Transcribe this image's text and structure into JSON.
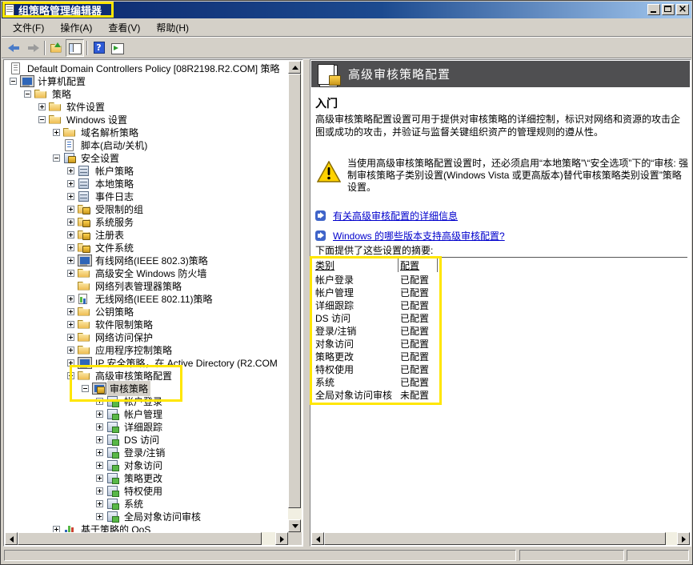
{
  "window": {
    "title": "组策略管理编辑器",
    "controls": [
      {
        "icon": "win-min",
        "name": "minimize-button"
      },
      {
        "icon": "win-max",
        "name": "maximize-button"
      },
      {
        "icon": "win-close",
        "name": "close-button"
      }
    ]
  },
  "menu": {
    "items": [
      "文件(F)",
      "操作(A)",
      "查看(V)",
      "帮助(H)"
    ]
  },
  "toolbar": {
    "buttons": [
      {
        "icon": "tb-back",
        "name": "back-button"
      },
      {
        "icon": "tb-forward",
        "name": "forward-button"
      },
      {
        "icon": "sep"
      },
      {
        "icon": "tb-up",
        "name": "up-level-button"
      },
      {
        "icon": "tb-tree",
        "name": "console-tree-toggle-button",
        "pressed": true
      },
      {
        "icon": "sep"
      },
      {
        "icon": "tb-help",
        "name": "help-button"
      },
      {
        "icon": "tb-win",
        "name": "show-window-button"
      }
    ]
  },
  "tree": {
    "items": [
      {
        "label": "Default Domain Controllers Policy [08R2198.R2.COM] 策略",
        "level": 1,
        "exp": "root",
        "icon": "gpo"
      },
      {
        "label": "计算机配置",
        "level": 1,
        "exp": "minus",
        "icon": "computer"
      },
      {
        "label": "策略",
        "level": 2,
        "exp": "minus",
        "icon": "folder"
      },
      {
        "label": "软件设置",
        "level": 3,
        "exp": "plus",
        "icon": "folder"
      },
      {
        "label": "Windows 设置",
        "level": 3,
        "exp": "minus",
        "icon": "folder"
      },
      {
        "label": "域名解析策略",
        "level": 4,
        "exp": "plus",
        "icon": "folder"
      },
      {
        "label": "脚本(启动/关机)",
        "level": 4,
        "exp": "leaf",
        "icon": "script"
      },
      {
        "label": "安全设置",
        "level": 4,
        "exp": "minus",
        "icon": "security"
      },
      {
        "label": "帐户策略",
        "level": 5,
        "exp": "plus",
        "icon": "cabinet"
      },
      {
        "label": "本地策略",
        "level": 5,
        "exp": "plus",
        "icon": "cabinet"
      },
      {
        "label": "事件日志",
        "level": 5,
        "exp": "plus",
        "icon": "cabinet"
      },
      {
        "label": "受限制的组",
        "level": 5,
        "exp": "plus",
        "icon": "folder-lock"
      },
      {
        "label": "系统服务",
        "level": 5,
        "exp": "plus",
        "icon": "folder-lock"
      },
      {
        "label": "注册表",
        "level": 5,
        "exp": "plus",
        "icon": "folder-lock"
      },
      {
        "label": "文件系统",
        "level": 5,
        "exp": "plus",
        "icon": "folder-lock"
      },
      {
        "label": "有线网络(IEEE 802.3)策略",
        "level": 5,
        "exp": "plus",
        "icon": "net"
      },
      {
        "label": "高级安全 Windows 防火墙",
        "level": 5,
        "exp": "plus",
        "icon": "folder"
      },
      {
        "label": "网络列表管理器策略",
        "level": 5,
        "exp": "leaf",
        "icon": "folder"
      },
      {
        "label": "无线网络(IEEE 802.11)策略",
        "level": 5,
        "exp": "plus",
        "icon": "wireless"
      },
      {
        "label": "公钥策略",
        "level": 5,
        "exp": "plus",
        "icon": "folder"
      },
      {
        "label": "软件限制策略",
        "level": 5,
        "exp": "plus",
        "icon": "folder"
      },
      {
        "label": "网络访问保护",
        "level": 5,
        "exp": "plus",
        "icon": "folder"
      },
      {
        "label": "应用程序控制策略",
        "level": 5,
        "exp": "plus",
        "icon": "folder"
      },
      {
        "label": "IP 安全策略，在 Active Directory (R2.COM",
        "level": 5,
        "exp": "plus",
        "icon": "ipsec"
      },
      {
        "label": "高级审核策略配置",
        "level": 5,
        "exp": "minus",
        "icon": "folder"
      },
      {
        "label": "审核策略",
        "level": 6,
        "exp": "minus",
        "icon": "audit",
        "selected": true
      },
      {
        "label": "帐户登录",
        "level": 7,
        "exp": "plus",
        "icon": "cabinet-green"
      },
      {
        "label": "帐户管理",
        "level": 7,
        "exp": "plus",
        "icon": "cabinet-green"
      },
      {
        "label": "详细跟踪",
        "level": 7,
        "exp": "plus",
        "icon": "cabinet-green"
      },
      {
        "label": "DS 访问",
        "level": 7,
        "exp": "plus",
        "icon": "cabinet-green"
      },
      {
        "label": "登录/注销",
        "level": 7,
        "exp": "plus",
        "icon": "cabinet-green"
      },
      {
        "label": "对象访问",
        "level": 7,
        "exp": "plus",
        "icon": "cabinet-green"
      },
      {
        "label": "策略更改",
        "level": 7,
        "exp": "plus",
        "icon": "cabinet-green"
      },
      {
        "label": "特权使用",
        "level": 7,
        "exp": "plus",
        "icon": "cabinet-green"
      },
      {
        "label": "系统",
        "level": 7,
        "exp": "plus",
        "icon": "cabinet-green"
      },
      {
        "label": "全局对象访问审核",
        "level": 7,
        "exp": "plus",
        "icon": "cabinet-green"
      },
      {
        "label": "基于策略的 QoS",
        "level": 4,
        "exp": "plus",
        "icon": "qos"
      }
    ]
  },
  "content": {
    "header_title": "高级审核策略配置",
    "section_title": "入门",
    "intro": "高级审核策略配置设置可用于提供对审核策略的详细控制，标识对网络和资源的攻击企图或成功的攻击，并验证与监督关键组织资产的管理规则的遵从性。",
    "warning": "当使用高级审核策略配置设置时，还必须启用“本地策略”\\“安全选项”下的“审核: 强制审核策略子类别设置(Windows Vista 或更高版本)替代审核策略类别设置”策略设置。",
    "links": [
      {
        "label": "有关高级审核配置的详细信息"
      },
      {
        "label": "Windows 的哪些版本支持高级审核配置?"
      }
    ],
    "summary_intro": "下面提供了这些设置的摘要:",
    "table": {
      "headers": [
        "类别",
        "配置"
      ],
      "rows": [
        {
          "category": "帐户登录",
          "status": "已配置"
        },
        {
          "category": "帐户管理",
          "status": "已配置"
        },
        {
          "category": "详细跟踪",
          "status": "已配置"
        },
        {
          "category": "DS 访问",
          "status": "已配置"
        },
        {
          "category": "登录/注销",
          "status": "已配置"
        },
        {
          "category": "对象访问",
          "status": "已配置"
        },
        {
          "category": "策略更改",
          "status": "已配置"
        },
        {
          "category": "特权使用",
          "status": "已配置"
        },
        {
          "category": "系统",
          "status": "已配置"
        },
        {
          "category": "全局对象访问审核",
          "status": "未配置"
        }
      ]
    }
  },
  "colors": {
    "highlight": "#ffe600",
    "titlebar_left": "#0a246a",
    "titlebar_right": "#a6caf0",
    "chrome": "#d4d0c8",
    "link": "#0000cc",
    "panel_header": "#4f4f51",
    "selection_bg": "#d4d0c8"
  }
}
